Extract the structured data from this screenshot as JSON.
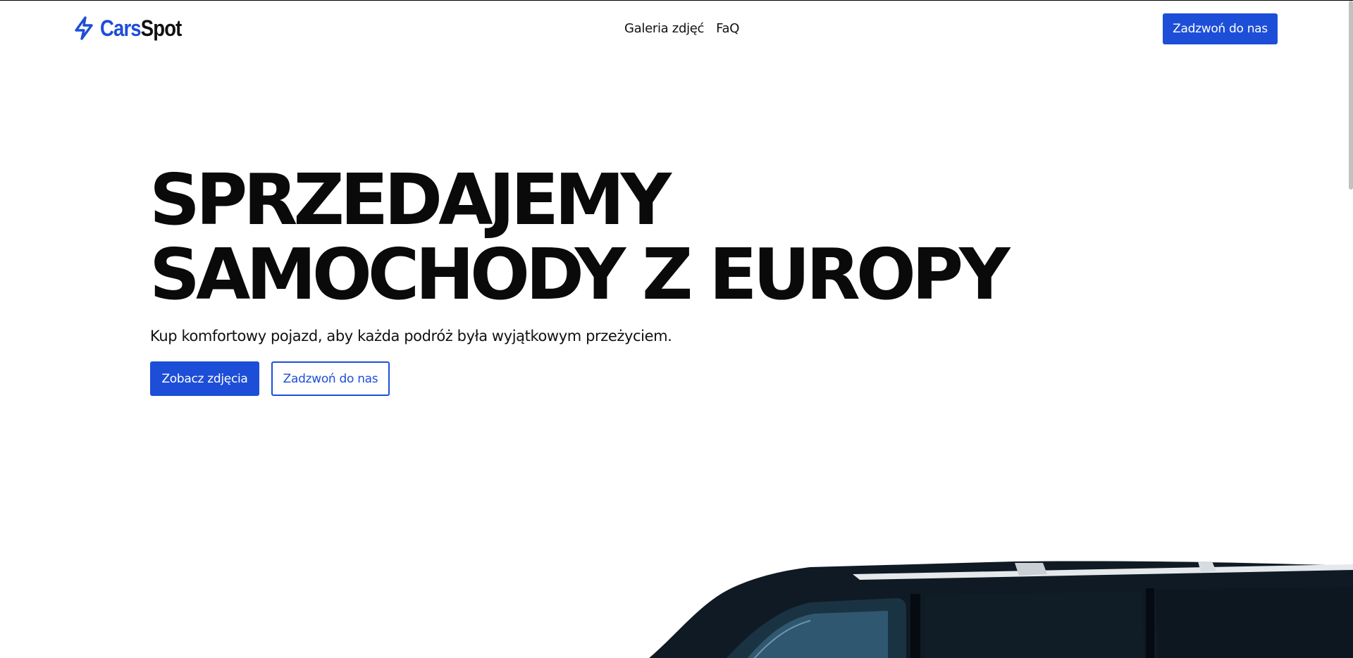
{
  "header": {
    "logo": {
      "part1": "Cars",
      "part2": "Spot",
      "icon": "lightning-bolt-icon"
    },
    "nav": [
      {
        "label": "Galeria zdjęć"
      },
      {
        "label": "FaQ"
      }
    ],
    "cta_label": "Zadzwoń do nas"
  },
  "hero": {
    "title_line1": "SPRZEDAJEMY",
    "title_line2": "SAMOCHODY Z EUROPY",
    "subtitle": "Kup komfortowy pojazd, aby każda podróż była wyjątkowym przeżyciem.",
    "primary_button": "Zobacz zdjęcia",
    "secondary_button": "Zadzwoń do nas"
  },
  "colors": {
    "accent": "#1d4ed8",
    "text": "#111111",
    "background": "#ffffff"
  }
}
